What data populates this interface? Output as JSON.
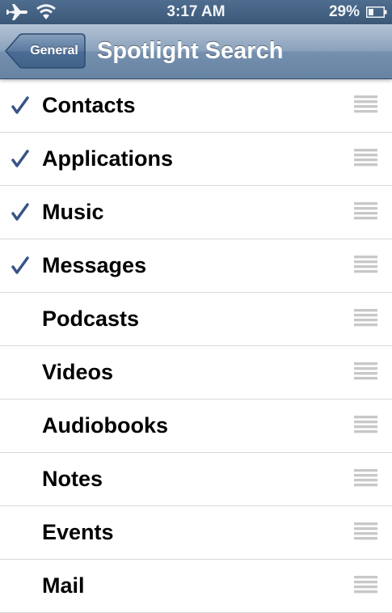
{
  "status_bar": {
    "time": "3:17 AM",
    "battery_percent": "29%",
    "icons": [
      "airplane-mode-icon",
      "wifi-icon",
      "battery-icon"
    ]
  },
  "nav_bar": {
    "back_label": "General",
    "title": "Spotlight Search"
  },
  "colors": {
    "checkmark": "#385487",
    "nav_bar": "#7590ae",
    "status_bar": "#3b5878"
  },
  "items": [
    {
      "label": "Contacts",
      "checked": true
    },
    {
      "label": "Applications",
      "checked": true
    },
    {
      "label": "Music",
      "checked": true
    },
    {
      "label": "Messages",
      "checked": true
    },
    {
      "label": "Podcasts",
      "checked": false
    },
    {
      "label": "Videos",
      "checked": false
    },
    {
      "label": "Audiobooks",
      "checked": false
    },
    {
      "label": "Notes",
      "checked": false
    },
    {
      "label": "Events",
      "checked": false
    },
    {
      "label": "Mail",
      "checked": false
    }
  ]
}
